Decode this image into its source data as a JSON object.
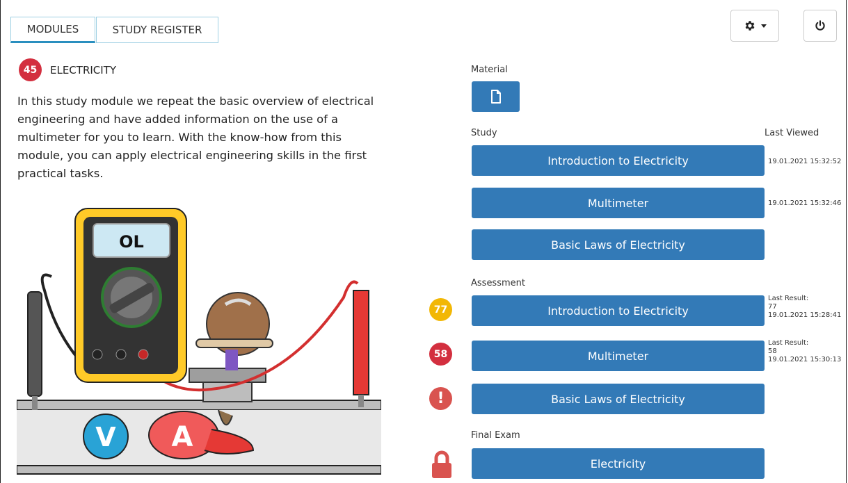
{
  "tabs": [
    {
      "label": "MODULES",
      "active": true
    },
    {
      "label": "STUDY REGISTER",
      "active": false
    }
  ],
  "toolbar": {
    "settings_icon": "gear-icon",
    "power_icon": "power-icon"
  },
  "module": {
    "badge": "45",
    "title": "ELECTRICITY",
    "description": "In this study module we repeat the basic overview of electrical engineering and have added information on the use of a multimeter for you to learn. With the know-how from this module, you can apply electrical engineering skills in the first practical tasks."
  },
  "illustration": {
    "display": "OL",
    "voltage_label": "V",
    "current_label": "A"
  },
  "material": {
    "label": "Material",
    "icon": "document-icon"
  },
  "study": {
    "label": "Study",
    "last_viewed_header": "Last Viewed",
    "items": [
      {
        "label": "Introduction to Electricity",
        "last_viewed": "19.01.2021 15:32:52"
      },
      {
        "label": "Multimeter",
        "last_viewed": "19.01.2021 15:32:46"
      },
      {
        "label": "Basic Laws of Electricity",
        "last_viewed": ""
      }
    ]
  },
  "assessment": {
    "label": "Assessment",
    "items": [
      {
        "label": "Introduction to Electricity",
        "score": "77",
        "result_label": "Last Result:",
        "result": "77",
        "date": "19.01.2021 15:28:41",
        "status_color": "#f2b705"
      },
      {
        "label": "Multimeter",
        "score": "58",
        "result_label": "Last Result:",
        "result": "58",
        "date": "19.01.2021 15:30:13",
        "status_color": "#d32f3f"
      },
      {
        "label": "Basic Laws of Electricity",
        "score": "!",
        "result_label": "",
        "result": "",
        "date": "",
        "status_color": "#d9534f"
      }
    ]
  },
  "final_exam": {
    "label": "Final Exam",
    "button": "Electricity",
    "icon": "lock-icon",
    "status_color": "#d9534f"
  },
  "colors": {
    "primary": "#337ab7",
    "tab_accent": "#2a8fbf"
  }
}
